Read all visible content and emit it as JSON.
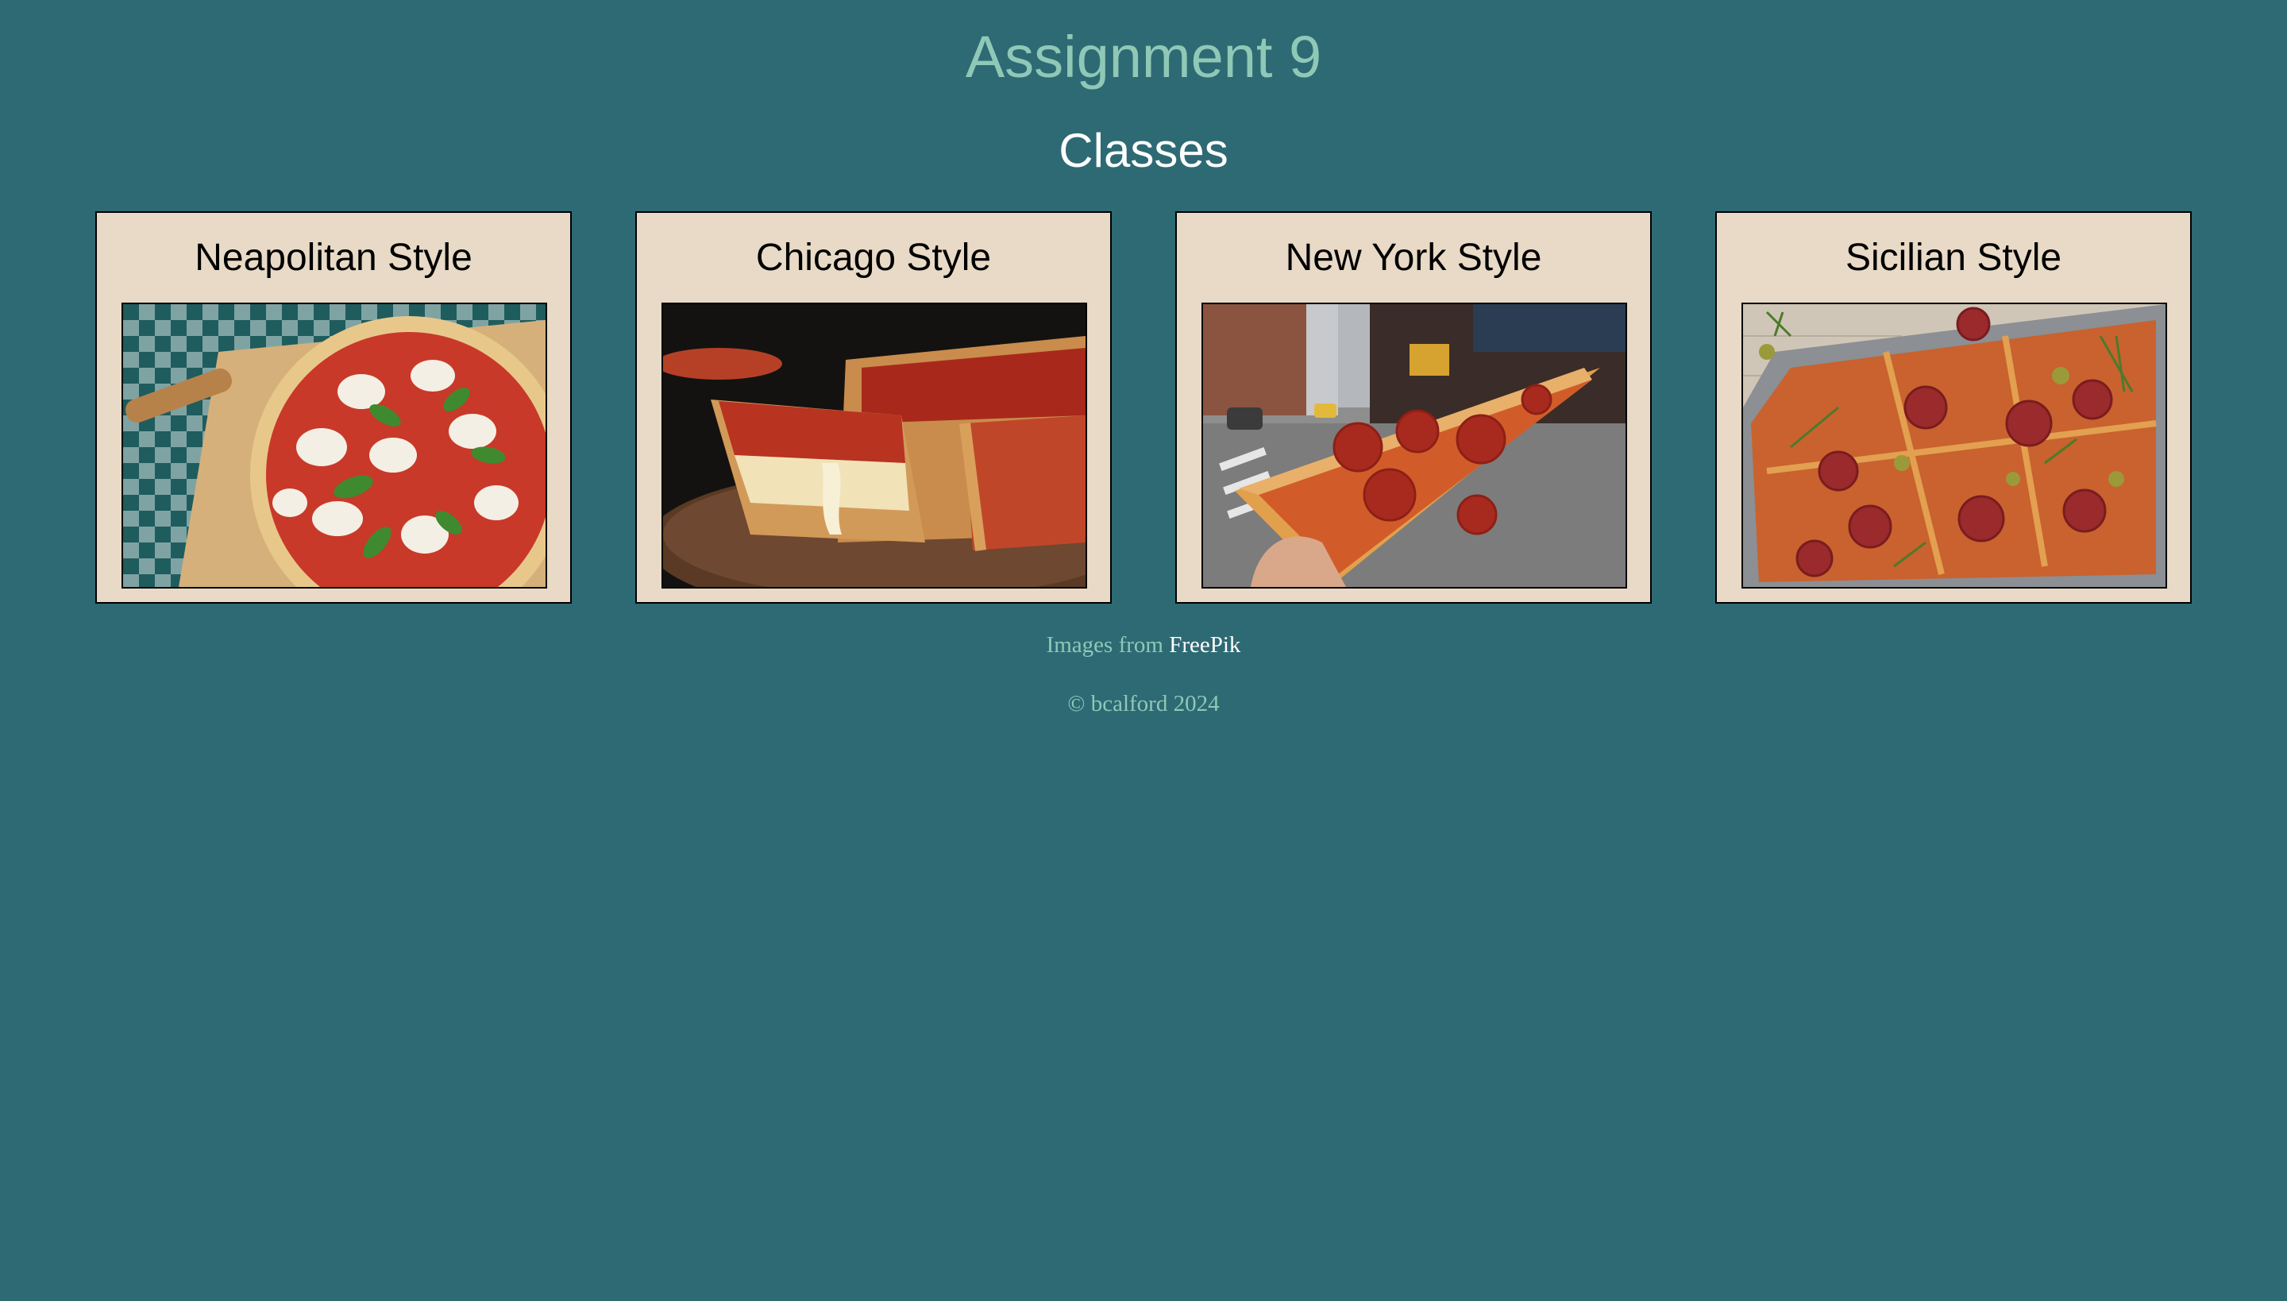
{
  "page": {
    "title": "Assignment 9",
    "section_title": "Classes"
  },
  "cards": [
    {
      "title": "Neapolitan Style",
      "image": "neapolitan-pizza-photo"
    },
    {
      "title": "Chicago Style",
      "image": "chicago-deep-dish-pizza-photo"
    },
    {
      "title": "New York Style",
      "image": "new-york-pizza-slice-photo"
    },
    {
      "title": "Sicilian Style",
      "image": "sicilian-pizza-photo"
    }
  ],
  "footer": {
    "credit_prefix": "Images from",
    "credit_link": "FreePik",
    "copyright": "© bcalford 2024"
  },
  "colors": {
    "background": "#2e6a74",
    "title": "#8fc8b6",
    "card_background": "#e8dac6",
    "link": "#ffffff"
  }
}
